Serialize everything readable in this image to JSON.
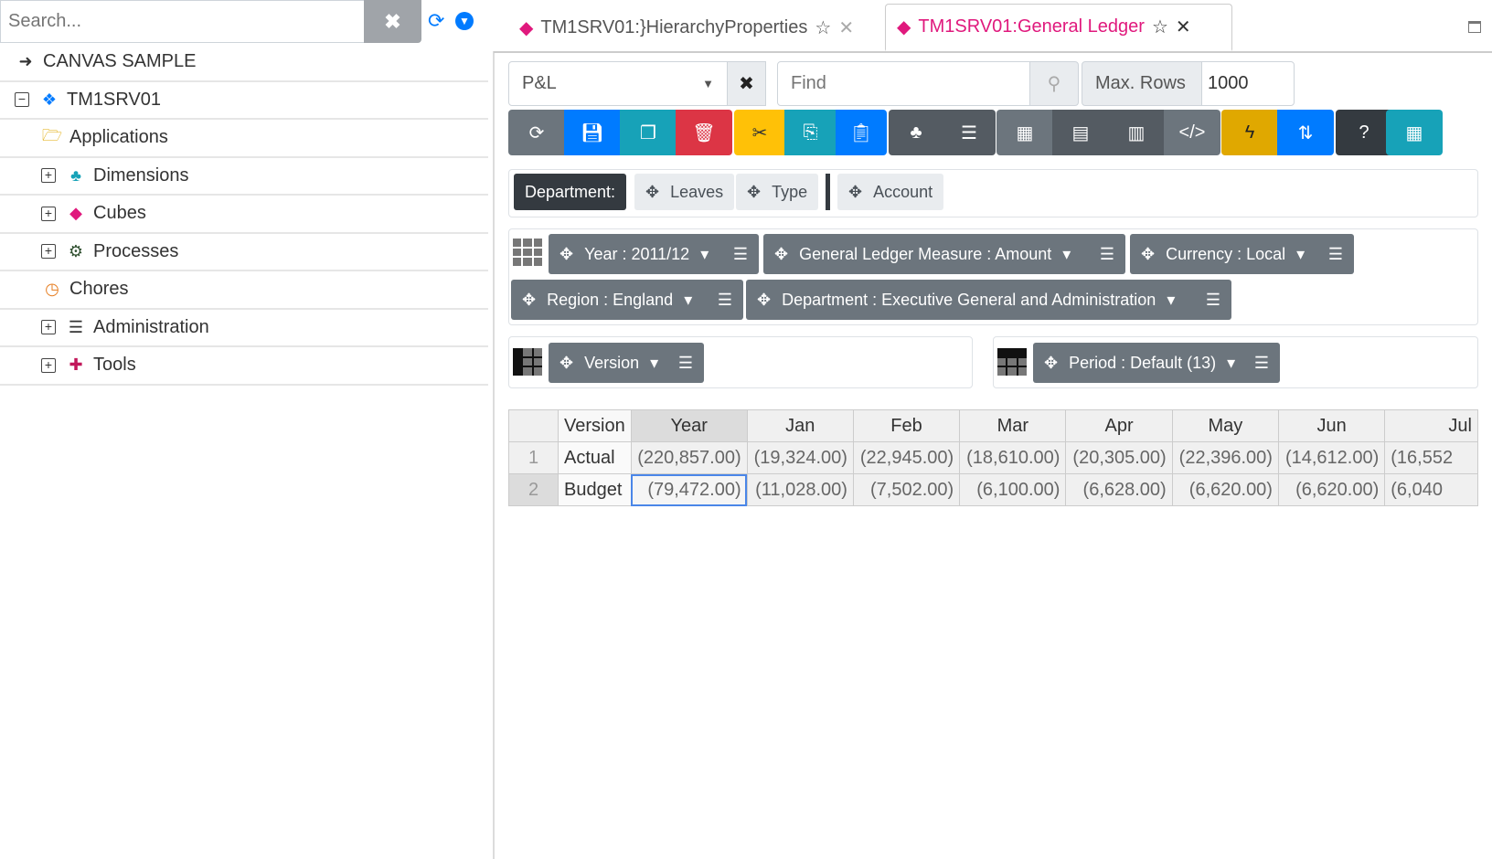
{
  "sidebar": {
    "search_placeholder": "Search...",
    "items": [
      {
        "label": "CANVAS SAMPLE",
        "icon": "sign-in-icon"
      },
      {
        "label": "TM1SRV01",
        "icon": "cubes-icon",
        "toggle": "−"
      },
      {
        "label": "Applications",
        "icon": "folder-open-icon"
      },
      {
        "label": "Dimensions",
        "icon": "sitemap-icon",
        "toggle": "+"
      },
      {
        "label": "Cubes",
        "icon": "cube-icon",
        "toggle": "+"
      },
      {
        "label": "Processes",
        "icon": "cogs-icon",
        "toggle": "+"
      },
      {
        "label": "Chores",
        "icon": "clock-icon"
      },
      {
        "label": "Administration",
        "icon": "server-icon",
        "toggle": "+"
      },
      {
        "label": "Tools",
        "icon": "puzzle-icon",
        "toggle": "+"
      }
    ]
  },
  "tabs": [
    {
      "label": "TM1SRV01:}HierarchyProperties"
    },
    {
      "label": "TM1SRV01:General Ledger"
    }
  ],
  "controls": {
    "view": "P&L",
    "find_placeholder": "Find",
    "max_rows_label": "Max. Rows",
    "max_rows": "1000"
  },
  "filters": {
    "department": "Department:",
    "leaves": "Leaves",
    "type": "Type",
    "account": "Account"
  },
  "titles": [
    "Year : 2011/12",
    "General Ledger Measure : Amount",
    "Currency : Local",
    "Region : England",
    "Department : Executive General and Administration"
  ],
  "rows_dim": "Version",
  "cols_dim": "Period : Default (13)",
  "grid": {
    "corner": "Version",
    "columns": [
      "Year",
      "Jan",
      "Feb",
      "Mar",
      "Apr",
      "May",
      "Jun",
      "Jul"
    ],
    "rows": [
      {
        "n": "1",
        "label": "Actual",
        "values": [
          "(220,857.00)",
          "(19,324.00)",
          "(22,945.00)",
          "(18,610.00)",
          "(20,305.00)",
          "(22,396.00)",
          "(14,612.00)",
          "(16,552"
        ]
      },
      {
        "n": "2",
        "label": "Budget",
        "values": [
          "(79,472.00)",
          "(11,028.00)",
          "(7,502.00)",
          "(6,100.00)",
          "(6,628.00)",
          "(6,620.00)",
          "(6,620.00)",
          "(6,040"
        ]
      }
    ]
  },
  "colors": {
    "accent": "#e0197d",
    "primary": "#007bff"
  }
}
